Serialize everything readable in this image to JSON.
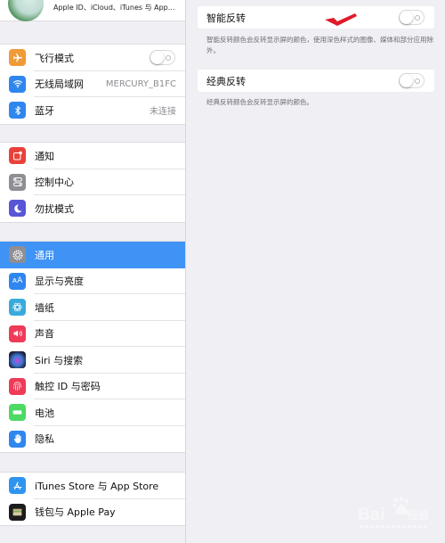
{
  "sidebar": {
    "profile": {
      "subtitle": "Apple ID、iCloud、iTunes 与 App..."
    },
    "groups": [
      {
        "items": [
          {
            "label": "飞行模式",
            "icon": "airplane-icon",
            "color": "#f19a38",
            "toggle": false
          },
          {
            "label": "无线局域网",
            "icon": "wifi-icon",
            "color": "#2f86ef",
            "value": "MERCURY_B1FC"
          },
          {
            "label": "蓝牙",
            "icon": "bluetooth-icon",
            "color": "#2f86ef",
            "value": "未连接"
          }
        ]
      },
      {
        "items": [
          {
            "label": "通知",
            "icon": "notifications-icon",
            "color": "#e8413a"
          },
          {
            "label": "控制中心",
            "icon": "control-center-icon",
            "color": "#8e8e93"
          },
          {
            "label": "勿扰模式",
            "icon": "moon-icon",
            "color": "#5856d6"
          }
        ]
      },
      {
        "items": [
          {
            "label": "通用",
            "icon": "gear-icon",
            "color": "#8e8e93",
            "selected": true
          },
          {
            "label": "显示与亮度",
            "icon": "display-brightness-icon",
            "color": "#2f86ef"
          },
          {
            "label": "墙纸",
            "icon": "wallpaper-icon",
            "color": "#38aadc"
          },
          {
            "label": "声音",
            "icon": "sound-icon",
            "color": "#ee3b57"
          },
          {
            "label": "Siri 与搜索",
            "icon": "siri-icon",
            "color": "#2b2b4a"
          },
          {
            "label": "触控 ID 与密码",
            "icon": "fingerprint-icon",
            "color": "#ee3b57"
          },
          {
            "label": "电池",
            "icon": "battery-icon",
            "color": "#4cd964"
          },
          {
            "label": "隐私",
            "icon": "hand-icon",
            "color": "#2f86ef"
          }
        ]
      },
      {
        "items": [
          {
            "label": "iTunes Store 与 App Store",
            "icon": "app-store-icon",
            "color": "#2f94f0"
          },
          {
            "label": "钱包与 Apple Pay",
            "icon": "wallet-icon",
            "color": "#1c1c1e"
          }
        ]
      }
    ]
  },
  "main": {
    "smart_invert": {
      "label": "智能反转",
      "enabled": false,
      "description": "智能反转颜色会反转显示屏的颜色，使用深色样式的图像、媒体和部分应用除外。"
    },
    "classic_invert": {
      "label": "经典反转",
      "enabled": false,
      "description": "经典反转颜色会反转显示屏的颜色。"
    },
    "annotation_color": "#e0192a"
  },
  "watermark": {
    "brand": "Bai",
    "brand_cn": "经验"
  }
}
